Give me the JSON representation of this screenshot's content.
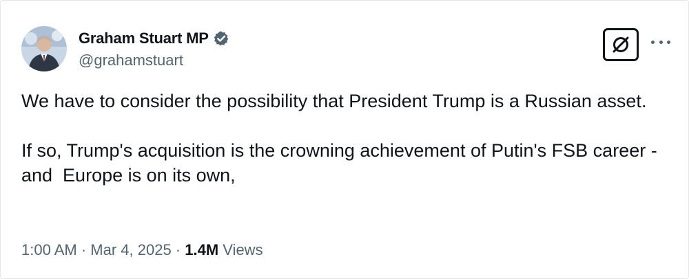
{
  "author": {
    "display_name": "Graham Stuart MP",
    "handle": "@grahamstuart",
    "verified": true,
    "verified_color": "#536471"
  },
  "tweet": {
    "text": "We have to consider the possibility that President Trump is a Russian asset.\n\nIf so, Trump's acquisition is the crowning achievement of Putin's FSB career - and  Europe is on its own,",
    "time": "1:00 AM",
    "date": "Mar 4, 2025",
    "separator": " · ",
    "views_count": "1.4M",
    "views_label": " Views"
  },
  "icons": {
    "grok": "grok-icon",
    "more": "more-options-icon",
    "verified": "verified-badge-icon",
    "avatar": "profile-avatar"
  },
  "colors": {
    "text_primary": "#0f1419",
    "text_secondary": "#536471",
    "border": "#e6e6e6"
  }
}
